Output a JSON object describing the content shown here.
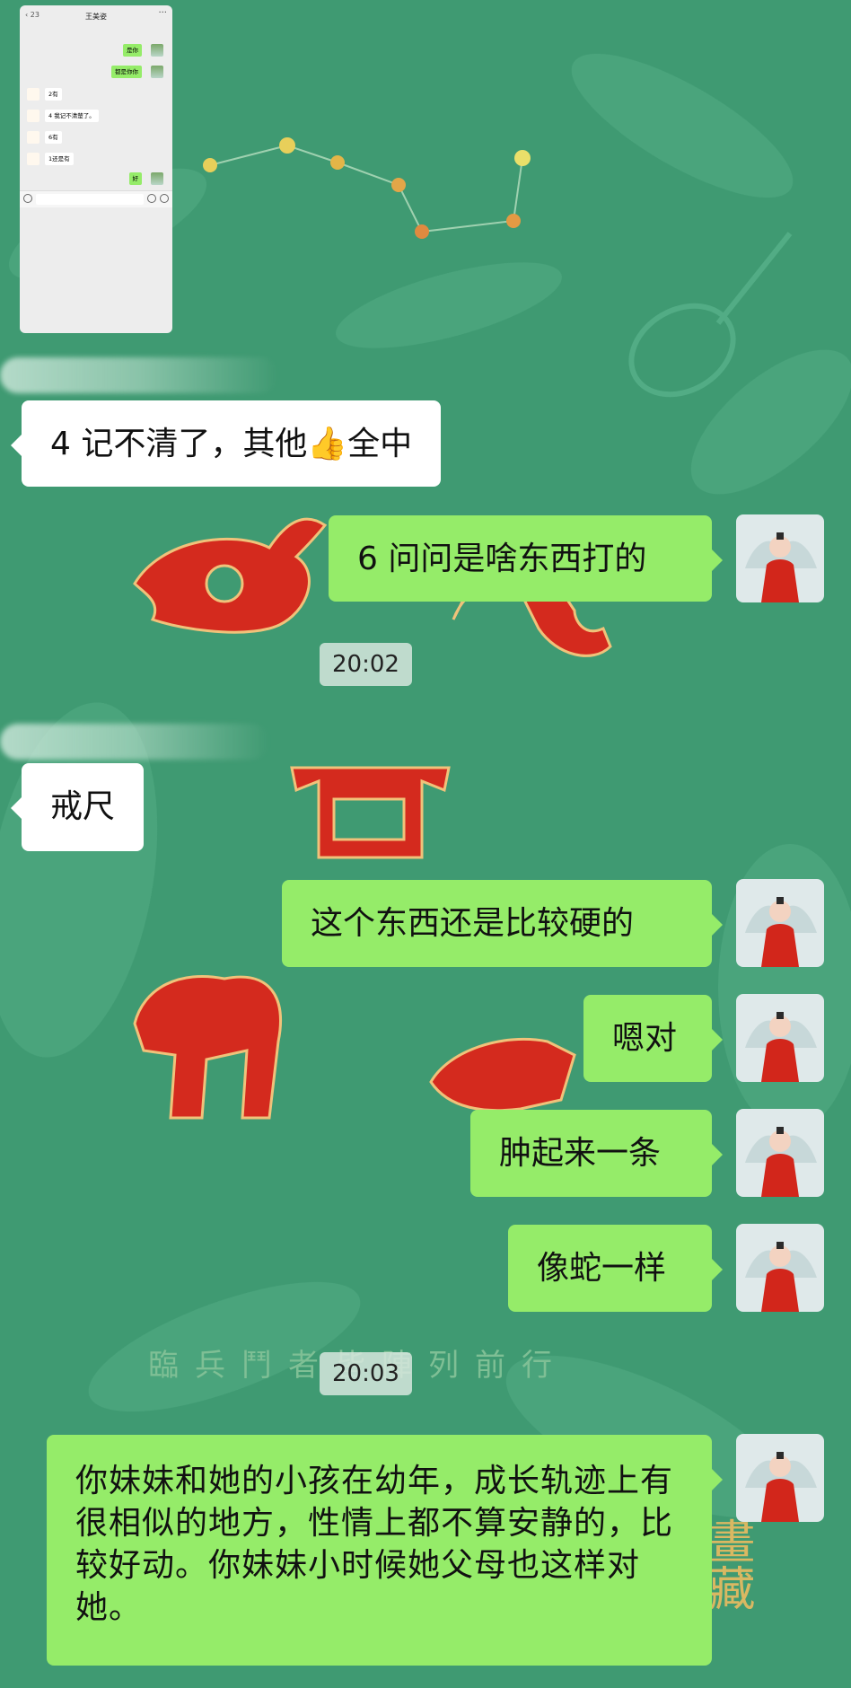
{
  "embedded_screenshot": {
    "contact_name": "王美姿",
    "messages": [
      {
        "side": "out",
        "text": "是你"
      },
      {
        "side": "out",
        "text": "都是你你"
      },
      {
        "side": "in",
        "text": "2有"
      },
      {
        "side": "in",
        "text": "4 我记不清楚了。"
      },
      {
        "side": "in",
        "text": "6有"
      },
      {
        "side": "in",
        "text": "1还是有"
      },
      {
        "side": "out",
        "text": "好"
      }
    ]
  },
  "messages": [
    {
      "side": "in",
      "text": "4 记不清了，其他👍全中"
    },
    {
      "side": "out",
      "text": "6 问问是啥东西打的"
    },
    {
      "side": "in",
      "text": "戒尺"
    },
    {
      "side": "out",
      "text": "这个东西还是比较硬的"
    },
    {
      "side": "out",
      "text": "嗯对"
    },
    {
      "side": "out",
      "text": "肿起来一条"
    },
    {
      "side": "out",
      "text": "像蛇一样"
    },
    {
      "side": "out",
      "text": "你妹妹和她的小孩在幼年，成长轨迹上有很相似的地方，性情上都不算安静的，比较好动。你妹妹小时候她父母也这样对她。"
    }
  ],
  "timestamps": [
    "20:02",
    "20:03"
  ],
  "wallpaper": {
    "background_color": "#3f9a72",
    "caption": "臨兵鬥者皆陣列前行",
    "side_text": "畫藏"
  },
  "colors": {
    "incoming_bubble": "#ffffff",
    "outgoing_bubble": "#95ec69",
    "wallpaper_red": "#d42a1e"
  }
}
